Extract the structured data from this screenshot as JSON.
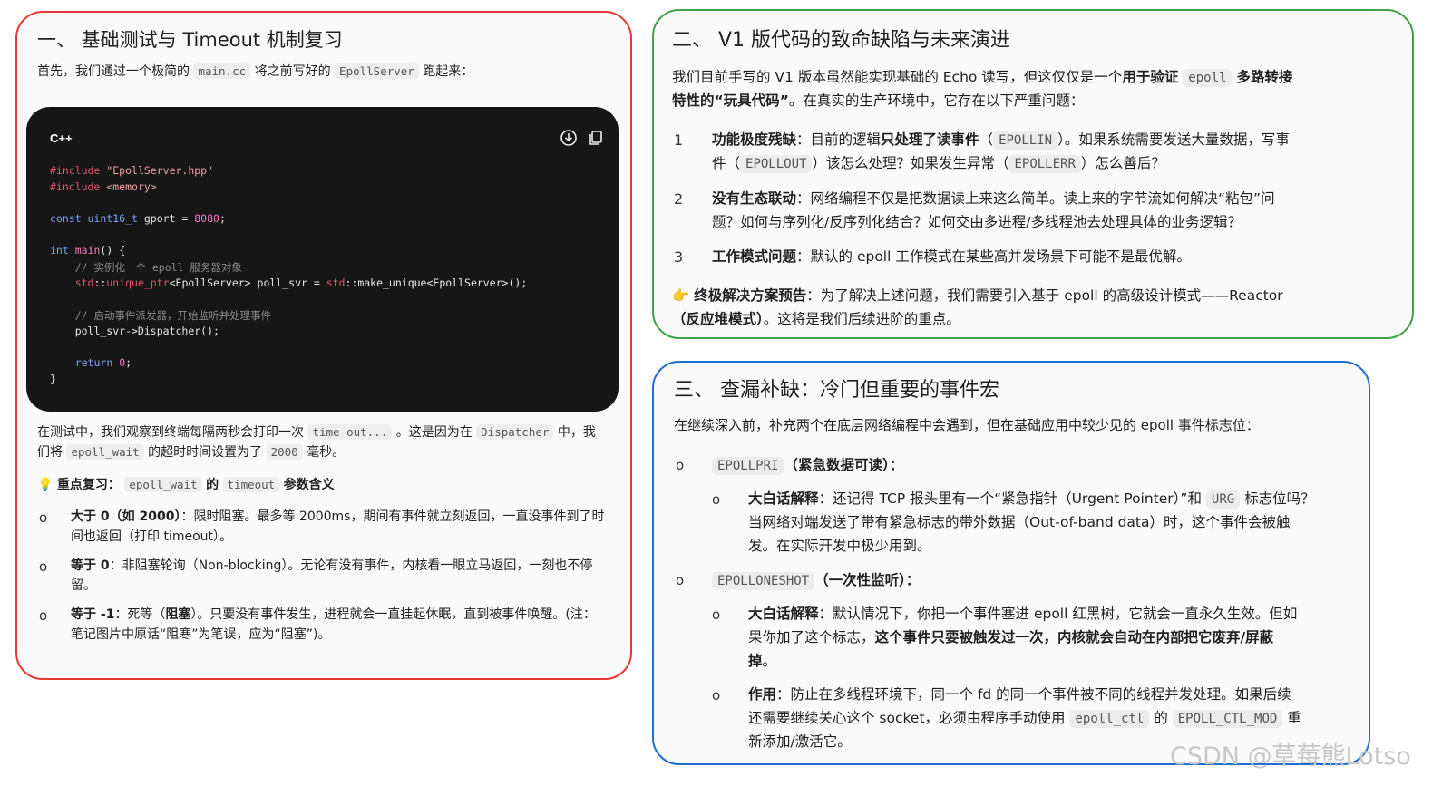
{
  "p1": {
    "title": "一、 基础测试与 Timeout 机制复习",
    "intro_a": "首先，我们通过一个极简的",
    "intro_code1": "main.cc",
    "intro_b": "将之前写好的",
    "intro_code2": "EpollServer",
    "intro_c": "跑起来：",
    "code_lang": "C++",
    "code_lines": [
      "#include \"EpollServer.hpp\"",
      "#include <memory>",
      "const uint16_t gport = 8080;",
      "int main() {",
      "    // 实例化一个 epoll 服务器对象",
      "    std::unique_ptr<EpollServer> poll_svr = std::make_unique<EpollServer>();",
      "    // 启动事件派发器，开始监听并处理事件",
      "    poll_svr->Dispatcher();",
      "    return 0;",
      "}"
    ],
    "desc_a": "在测试中，我们观察到终端每隔两秒会打印一次",
    "desc_code1": "time out...",
    "desc_b": "。这是因为在",
    "desc_code2": "Dispatcher",
    "desc_c": "中，我",
    "desc_d": "们将",
    "desc_code3": "epoll_wait",
    "desc_e": "的超时时间设置为了",
    "desc_code4": "2000",
    "desc_f": "毫秒。",
    "key_emoji": "💡",
    "key_a": "重点复习：",
    "key_code1": "epoll_wait",
    "key_b": "的",
    "key_code2": "timeout",
    "key_c": "参数含义",
    "bullets": [
      {
        "bold": "大于 0（如 2000）",
        "text": "：限时阻塞。最多等 2000ms，期间有事件就立刻返回，一直没事件到了时",
        "text2": "间也返回（打印 timeout）。"
      },
      {
        "bold": "等于 0",
        "text": "：非阻塞轮询（Non-blocking）。无论有没有事件，内核看一眼立马返回，一刻也不停",
        "text2": "留。"
      },
      {
        "bold": "等于 -1",
        "text": "：死等（",
        "bold2": "阻塞",
        "text_b": "）。只要没有事件发生，进程就会一直挂起休眠，直到被事件唤醒。(注：",
        "text2": "笔记图片中原话“阻寒”为笔误，应为“阻塞”)。"
      }
    ]
  },
  "p2": {
    "title": "二、 V1 版代码的致命缺陷与未来演进",
    "intro_a": "我们目前手写的 V1 版本虽然能实现基础的 Echo 读写，但这仅仅是一个",
    "intro_bold1": "用于验证",
    "intro_code": "epoll",
    "intro_bold2": "多路转接",
    "intro_bold3": "特性的“玩具代码”",
    "intro_b": "。在真实的生产环境中，它存在以下严重问题：",
    "items": [
      {
        "n": "1",
        "bold": "功能极度残缺",
        "a": "：目前的逻辑",
        "bold2": "只处理了读事件",
        "b": "（",
        "code1": "EPOLLIN",
        "c": "）。如果系统需要发送大量数据，写事",
        "d": "件（",
        "code2": "EPOLLOUT",
        "e": "）该怎么处理？如果发生异常（",
        "code3": "EPOLLERR",
        "f": "）怎么善后？"
      },
      {
        "n": "2",
        "bold": "没有生态联动",
        "a": "：网络编程不仅是把数据读上来这么简单。读上来的字节流如何解决“粘包”问",
        "d": "题？如何与序列化/反序列化结合？如何交由多进程/多线程池去处理具体的业务逻辑？"
      },
      {
        "n": "3",
        "bold": "工作模式问题",
        "a": "：默认的 epoll 工作模式在某些高并发场景下可能不是最优解。"
      }
    ],
    "final_emoji": "👉",
    "final_bold": "终极解决方案预告",
    "final_a": "：为了解决上述问题，我们需要引入基于 epoll 的高级设计模式——Reactor",
    "final_bold2": "（反应堆模式）",
    "final_b": "。这将是我们后续进阶的重点。"
  },
  "p3": {
    "title": "三、 查漏补缺：冷门但重要的事件宏",
    "intro": "在继续深入前，补充两个在底层网络编程中会遇到，但在基础应用中较少见的 epoll 事件标志位：",
    "pri_code": "EPOLLPRI",
    "pri_label": "（紧急数据可读）：",
    "pri_bold": "大白话解释",
    "pri_a": "：还记得 TCP 报头里有一个“紧急指针（Urgent Pointer）”和",
    "pri_code2": "URG",
    "pri_b": "标志位吗？",
    "pri_line2": "当网络对端发送了带有紧急标志的带外数据（Out-of-band data）时，这个事件会被触",
    "pri_line3": "发。在实际开发中极少用到。",
    "one_code": "EPOLLONESHOT",
    "one_label": "（一次性监听）：",
    "one_bold": "大白话解释",
    "one_a": "：默认情况下，你把一个事件塞进 epoll 红黑树，它就会一直永久生效。但如",
    "one_line2a": "果你加了这个标志，",
    "one_line2bold": "这个事件只要被触发过一次，内核就会自动在内部把它废弃/屏蔽",
    "one_line3bold": "掉",
    "one_line3": "。",
    "use_bold": "作用",
    "use_a": "：防止在多线程环境下，同一个 fd 的同一个事件被不同的线程并发处理。如果后续",
    "use_line2a": "还需要继续关心这个 socket，必须由程序手动使用",
    "use_code1": "epoll_ctl",
    "use_line2b": "的",
    "use_code2": "EPOLL_CTL_MOD",
    "use_line2c": "重",
    "use_line3": "新添加/激活它。"
  },
  "watermark": "CSDN @草莓熊Lotso"
}
